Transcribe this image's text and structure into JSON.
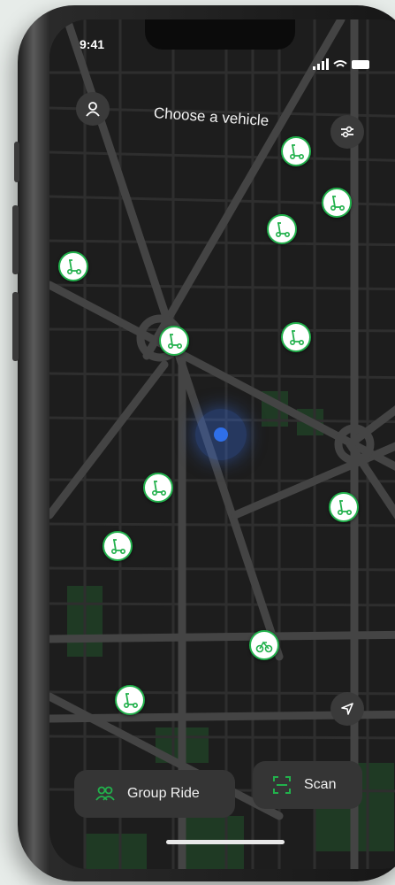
{
  "status_bar": {
    "time": "9:41"
  },
  "header": {
    "title": "Choose a vehicle"
  },
  "icons": {
    "profile": "user-icon",
    "filter": "sliders-icon",
    "locate": "navigation-arrow-icon",
    "group_ride": "group-icon",
    "scan": "scan-icon",
    "scooter": "scooter-icon",
    "bike": "bike-icon"
  },
  "actions": {
    "group_ride_label": "Group Ride",
    "scan_label": "Scan"
  },
  "map": {
    "vehicles": [
      {
        "id": "v1",
        "type": "scooter"
      },
      {
        "id": "v2",
        "type": "scooter"
      },
      {
        "id": "v3",
        "type": "scooter"
      },
      {
        "id": "v4",
        "type": "scooter"
      },
      {
        "id": "v5",
        "type": "scooter"
      },
      {
        "id": "v6",
        "type": "scooter"
      },
      {
        "id": "v7",
        "type": "scooter"
      },
      {
        "id": "v8",
        "type": "scooter"
      },
      {
        "id": "v9",
        "type": "scooter"
      },
      {
        "id": "v10",
        "type": "bike"
      },
      {
        "id": "v11",
        "type": "scooter"
      }
    ]
  },
  "colors": {
    "accent_green": "#22b14c",
    "user_location_blue": "#2f6fe9",
    "map_background": "#1d1d1d",
    "road": "#3a3a3a",
    "park": "#1f3a24"
  }
}
